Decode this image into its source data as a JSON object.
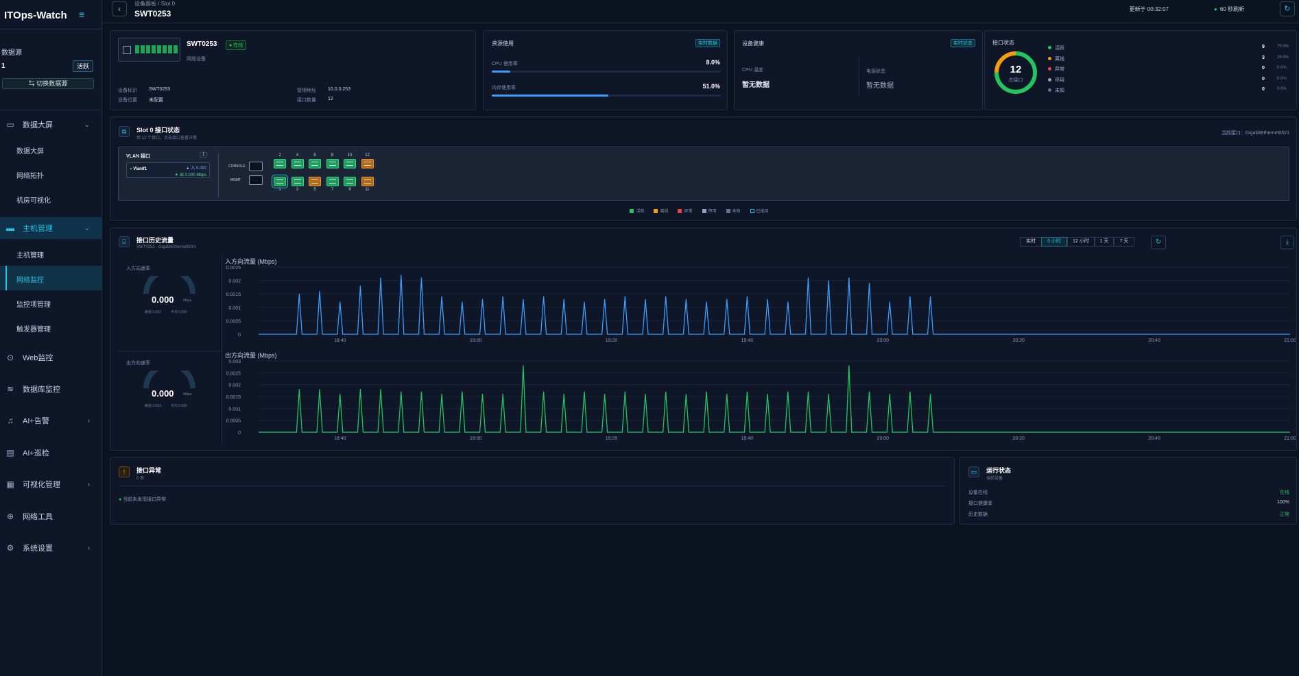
{
  "app": {
    "title": "ITOps-Watch",
    "menu_icon": "hamburger-icon"
  },
  "datasource": {
    "label": "数据源",
    "count": "1",
    "status": "活跃",
    "switch_label": "切换数据源"
  },
  "nav": [
    {
      "label": "数据大屏",
      "icon": "monitor-icon",
      "chevron": "⌄"
    },
    {
      "label": "主机管理",
      "icon": "host-icon",
      "chevron": "⌄",
      "active": true
    },
    {
      "label": "Web监控",
      "icon": "web-icon"
    },
    {
      "label": "数据库监控",
      "icon": "database-icon"
    },
    {
      "label": "AI+告警",
      "icon": "bell-icon",
      "chevron": "›"
    },
    {
      "label": "AI+巡检",
      "icon": "document-icon"
    },
    {
      "label": "可视化管理",
      "icon": "grid-icon",
      "chevron": "›"
    },
    {
      "label": "网络工具",
      "icon": "tool-icon"
    },
    {
      "label": "系统设置",
      "icon": "gear-icon",
      "chevron": "›"
    }
  ],
  "sub_dashboard": [
    "数据大屏",
    "网络拓扑",
    "机房可视化"
  ],
  "sub_host": [
    "主机管理",
    "网络监控",
    "监控项管理",
    "触发器管理"
  ],
  "topbar": {
    "breadcrumb": "设备面板 / Slot 0",
    "device": "SWT0253",
    "updated": "更新于 00:32:07",
    "refresh": "60 秒刷新"
  },
  "device": {
    "name": "SWT0253",
    "status": "在线",
    "type": "网络设备",
    "fields": [
      {
        "k": "设备标识",
        "v": "SWT0253"
      },
      {
        "k": "管理地址",
        "v": "10.0.0.253"
      },
      {
        "k": "设备位置",
        "v": "未配置"
      },
      {
        "k": "接口数量",
        "v": "12"
      }
    ]
  },
  "resource": {
    "title": "资源使用",
    "tag": "实时数据",
    "cpu_label": "CPU 使用率",
    "cpu": "8.0%",
    "cpu_pct": 8,
    "mem_label": "内存使用率",
    "mem": "51.0%",
    "mem_pct": 51
  },
  "health": {
    "title": "设备健康",
    "tag": "实时状态",
    "cpu_temp_label": "CPU 温度",
    "cpu_temp": "暂无数据",
    "power_label": "电源状态",
    "power": "暂无数据"
  },
  "ifstatus": {
    "title": "接口状态",
    "total": "12",
    "total_label": "总接口",
    "items": [
      {
        "label": "活跃",
        "count": "9",
        "pct": "75.0%",
        "color": "#22c55e",
        "frac": 0.75
      },
      {
        "label": "离线",
        "count": "3",
        "pct": "25.0%",
        "color": "#f59e0b",
        "frac": 0.25
      },
      {
        "label": "异常",
        "count": "0",
        "pct": "0.0%",
        "color": "#ef4444"
      },
      {
        "label": "停用",
        "count": "0",
        "pct": "0.0%",
        "color": "#94a3b8"
      },
      {
        "label": "未知",
        "count": "0",
        "pct": "0.0%",
        "color": "#64748b"
      }
    ]
  },
  "slot": {
    "title": "Slot 0 接口状态",
    "subtitle": "共 12 个接口，点击接口查看详情",
    "current": "当前接口：GigabitEthernet0/0/1",
    "vlan_title": "VLAN 接口",
    "vlan_count": "1",
    "vlan_name": "Vlanif1",
    "vlan_in": "▲ 入 0.000",
    "vlan_out": "▼ 出 0.000 Mbps",
    "console": "CONSOLE",
    "mgmt": "MGMT",
    "top_ports": [
      "2",
      "4",
      "6",
      "8",
      "10",
      "12"
    ],
    "bottom_ports": [
      "1",
      "3",
      "5",
      "7",
      "9",
      "11"
    ],
    "top_state": [
      "up",
      "up",
      "up",
      "up",
      "up",
      "warn"
    ],
    "bottom_state": [
      "up",
      "up",
      "warn",
      "up",
      "up",
      "warn"
    ],
    "legend": [
      {
        "label": "活跃",
        "color": "#22c55e"
      },
      {
        "label": "离线",
        "color": "#f59e0b"
      },
      {
        "label": "异常",
        "color": "#ef4444"
      },
      {
        "label": "停用",
        "color": "#94a3b8"
      },
      {
        "label": "未知",
        "color": "#64748b"
      },
      {
        "label": "已选择",
        "color": "#22c3e6"
      }
    ]
  },
  "traffic": {
    "title": "接口历史流量",
    "subtitle": "SWT0253 · GigabitEthernet0/0/1",
    "ranges": [
      "实时",
      "6 小时",
      "12 小时",
      "1 天",
      "7 天"
    ],
    "selected": "6 小时",
    "in_gauge": {
      "label": "入方向速率",
      "value": "0.000",
      "unit": "Mbps",
      "peak": "峰值 0.002",
      "avg": "平均 0.000"
    },
    "out_gauge": {
      "label": "出方向速率",
      "value": "0.000",
      "unit": "Mbps",
      "peak": "峰值 0.003",
      "avg": "平均 0.000"
    }
  },
  "alerts": {
    "title": "接口异常",
    "subtitle": "0 项",
    "empty": "当前未发现接口异常"
  },
  "runtime": {
    "title": "运行状态",
    "subtitle": "当前设备",
    "rows": [
      {
        "k": "设备在线",
        "v": "在线",
        "color": "#22c55e"
      },
      {
        "k": "接口健康率",
        "v": "100%",
        "color": "#c8d3e6"
      },
      {
        "k": "历史数据",
        "v": "正常",
        "color": "#22c55e"
      }
    ]
  },
  "chart_data": [
    {
      "type": "line",
      "title": "入方向流量 (Mbps)",
      "x_ticks": [
        "18:40",
        "19:00",
        "19:20",
        "19:40",
        "20:00",
        "20:20",
        "20:40",
        "21:00"
      ],
      "y_ticks": [
        "0",
        "0.0005",
        "0.001",
        "0.0015",
        "0.002",
        "0.0025"
      ],
      "ylim": [
        0,
        0.0025
      ],
      "series": [
        {
          "values": [
            0.0015,
            0.0016,
            0.0012,
            0.0018,
            0.0021,
            0.0022,
            0.0021,
            0.0014,
            0.0012,
            0.0013,
            0.0014,
            0.0013,
            0.0014,
            0.0013,
            0.0012,
            0.0013,
            0.0014,
            0.0013,
            0.0014,
            0.0013,
            0.0012,
            0.0013,
            0.0014,
            0.0013,
            0.0012,
            0.0021,
            0.002,
            0.0021,
            0.0019,
            0.0012,
            0.0014,
            0.0014
          ],
          "color": "#3b9eff"
        }
      ],
      "x_first": "18:34",
      "x_step_min": 3
    },
    {
      "type": "line",
      "title": "出方向流量 (Mbps)",
      "x_ticks": [
        "18:40",
        "19:00",
        "19:20",
        "19:40",
        "20:00",
        "20:20",
        "20:40",
        "21:00"
      ],
      "y_ticks": [
        "0",
        "0.0005",
        "0.001",
        "0.0015",
        "0.002",
        "0.0025",
        "0.003"
      ],
      "ylim": [
        0,
        0.003
      ],
      "series": [
        {
          "values": [
            0.0018,
            0.0018,
            0.0016,
            0.0018,
            0.0018,
            0.0017,
            0.0017,
            0.0016,
            0.0017,
            0.0016,
            0.0016,
            0.0028,
            0.0017,
            0.0016,
            0.0017,
            0.0016,
            0.0017,
            0.0016,
            0.0017,
            0.0016,
            0.0017,
            0.0016,
            0.0017,
            0.0016,
            0.0017,
            0.0017,
            0.0016,
            0.0028,
            0.0017,
            0.0016,
            0.0017,
            0.0016
          ],
          "color": "#22c55e"
        }
      ],
      "x_first": "18:34",
      "x_step_min": 3
    }
  ]
}
